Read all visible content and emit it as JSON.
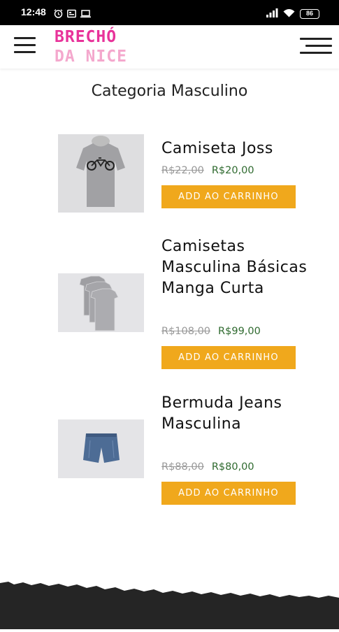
{
  "status_bar": {
    "time": "12:48",
    "left_icons": [
      "alarm-icon",
      "image-notification-icon",
      "laptop-icon"
    ],
    "battery_level": "86",
    "right_icons": [
      "signal-icon",
      "wifi-icon",
      "battery-icon"
    ]
  },
  "header": {
    "logo_line1": "BRECHÓ",
    "logo_line2": "DA NICE",
    "logo_colors": [
      "#e8339a",
      "#f4a8cd"
    ]
  },
  "page": {
    "title": "Categoria Masculino"
  },
  "products": [
    {
      "name": "Camiseta Joss",
      "old_price": "R$22,00",
      "new_price": "R$20,00",
      "button_label": "ADD AO CARRINHO",
      "image": "gray-tshirt-with-bicycle-print"
    },
    {
      "name": "Camisetas Masculina Básicas Manga Curta",
      "old_price": "R$108,00",
      "new_price": "R$99,00",
      "button_label": "ADD AO CARRINHO",
      "image": "stack-of-gray-tshirts"
    },
    {
      "name": "Bermuda Jeans Masculina",
      "old_price": "R$88,00",
      "new_price": "R$80,00",
      "button_label": "ADD AO CARRINHO",
      "image": "denim-shorts"
    }
  ],
  "colors": {
    "accent_button": "#f0a81c",
    "sale_price": "#2f6a2f",
    "old_price": "#999999",
    "footer": "#252525"
  }
}
